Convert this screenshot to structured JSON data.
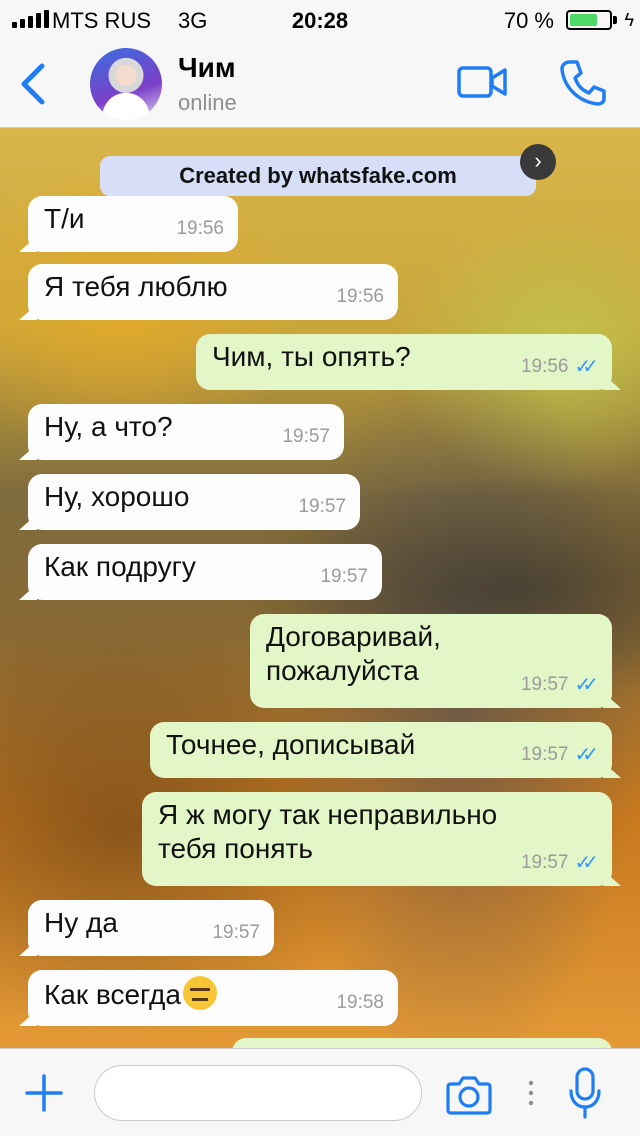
{
  "status_bar": {
    "carrier": "MTS RUS",
    "network": "3G",
    "time": "20:28",
    "battery_percent": "70 %",
    "battery_level": 0.7,
    "signal_icon": "signal-bars-icon",
    "battery_icon": "battery-icon",
    "charging_icon": "charging-bolt-icon"
  },
  "header": {
    "contact_name": "Чим",
    "contact_status": "online",
    "back_icon": "chevron-left-icon",
    "video_icon": "video-camera-icon",
    "call_icon": "phone-icon"
  },
  "banner": {
    "text": "Created by whatsfake.com",
    "close_glyph": "›"
  },
  "messages": [
    {
      "direction": "in",
      "lines": [
        "Т/и"
      ],
      "time": "19:56"
    },
    {
      "direction": "in",
      "lines": [
        "Я тебя люблю"
      ],
      "time": "19:56"
    },
    {
      "direction": "out",
      "lines": [
        "Чим, ты опять?"
      ],
      "time": "19:56",
      "ticks": "✓✓"
    },
    {
      "direction": "in",
      "lines": [
        "Ну, а что?"
      ],
      "time": "19:57"
    },
    {
      "direction": "in",
      "lines": [
        "Ну, хорошо"
      ],
      "time": "19:57"
    },
    {
      "direction": "in",
      "lines": [
        "Как подругу"
      ],
      "time": "19:57"
    },
    {
      "direction": "out",
      "lines": [
        "Договаривай,",
        "пожалуйста"
      ],
      "time": "19:57",
      "ticks": "✓✓"
    },
    {
      "direction": "out",
      "lines": [
        "Точнее, дописывай"
      ],
      "time": "19:57",
      "ticks": "✓✓"
    },
    {
      "direction": "out",
      "lines": [
        "Я ж могу так неправильно",
        "тебя понять"
      ],
      "time": "19:57",
      "ticks": "✓✓"
    },
    {
      "direction": "in",
      "lines": [
        "Ну да"
      ],
      "time": "19:57"
    },
    {
      "direction": "in",
      "lines": [
        "Как всегда"
      ],
      "time": "19:58",
      "emoji": "expressionless-face-emoji"
    }
  ],
  "input_bar": {
    "placeholder": "",
    "plus_icon": "plus-icon",
    "camera_icon": "camera-icon",
    "more_icon": "vertical-dots-icon",
    "mic_icon": "microphone-icon"
  },
  "colors": {
    "accent": "#1f7ef5",
    "incoming_bubble": "#fdfdfd",
    "outgoing_bubble": "#e3f6c8",
    "read_ticks": "#3497f9",
    "battery": "#4cd964"
  }
}
